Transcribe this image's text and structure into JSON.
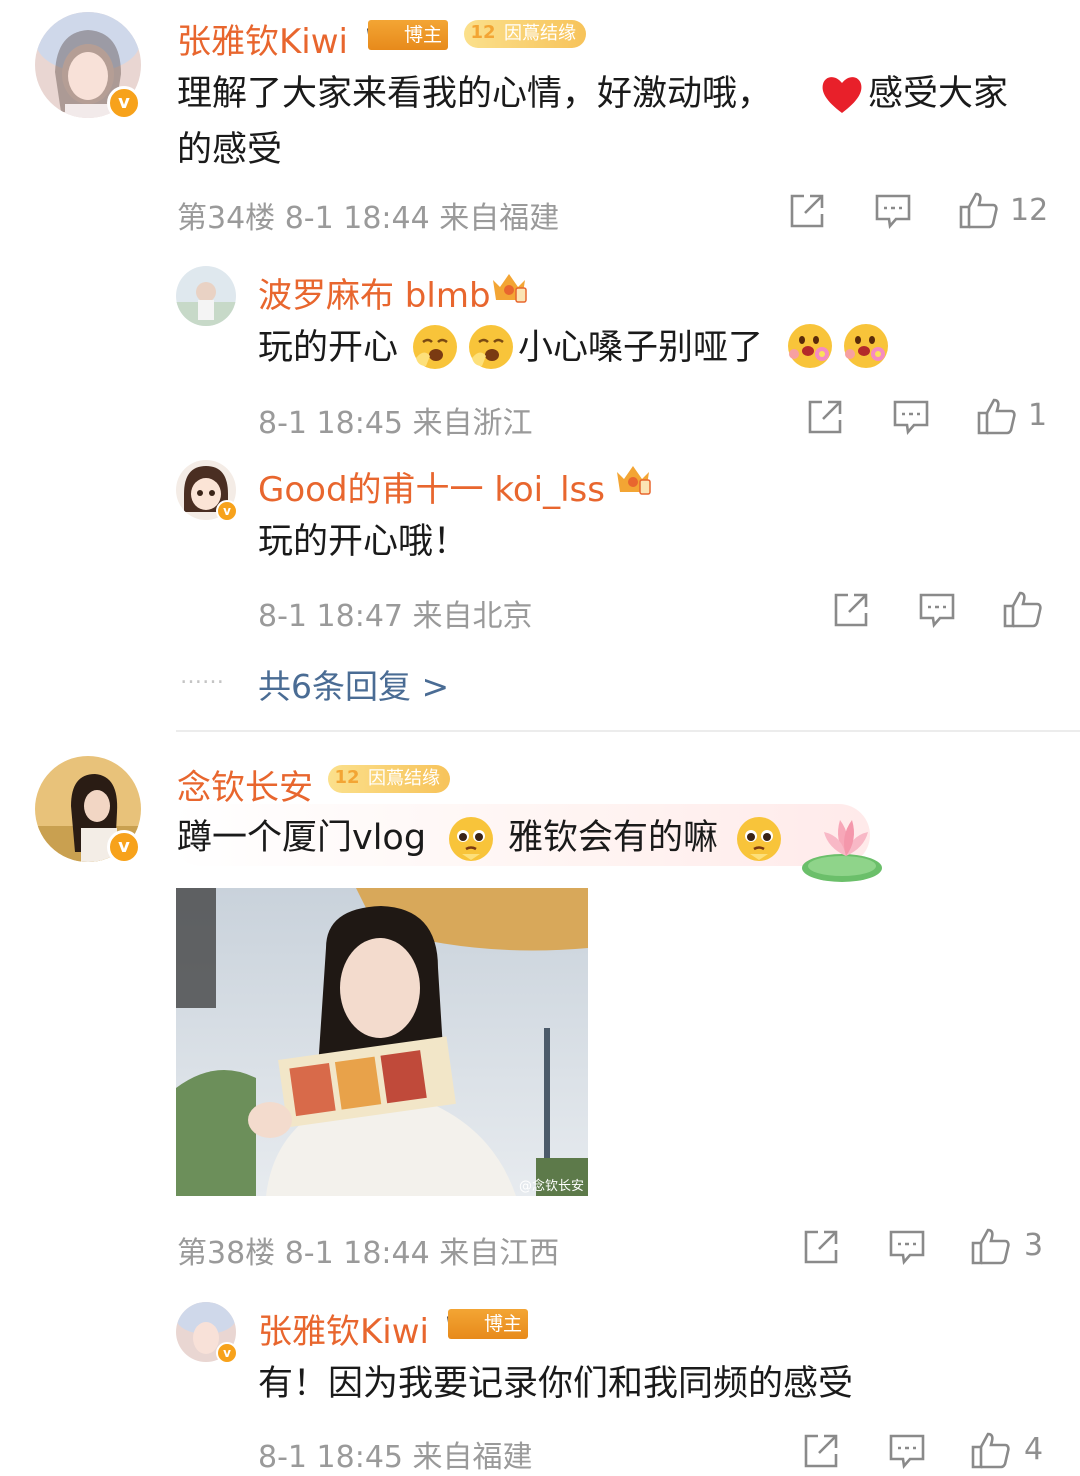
{
  "comments": [
    {
      "user": "张雅钦Kiwi",
      "badge_host": "博主",
      "badge_level_num": "12",
      "badge_level_text": "因蔦结缘",
      "text_line1_a": "理解了大家来看我的心情，好激动哦，",
      "text_line1_b": "感受大家",
      "text_line2": "的感受",
      "meta": "第34楼 8-1 18:44 来自福建",
      "likes": "12",
      "replies": [
        {
          "user": "波罗麻布 blmb",
          "text_a": "玩的开心",
          "text_b": "小心嗓子别哑了",
          "meta": "8-1 18:45 来自浙江",
          "likes": "1"
        },
        {
          "user": "Good的甫十一 koi_lss",
          "text": "玩的开心哦！",
          "meta": "8-1 18:47 来自北京",
          "likes": ""
        }
      ],
      "more_dots": "……",
      "more_label": "共6条回复 >"
    },
    {
      "user": "念钦长安",
      "badge_level_num": "12",
      "badge_level_text": "因蔦结缘",
      "text_a": "蹲一个厦门vlog",
      "text_b": "雅钦会有的嘛",
      "photo_watermark": "@念钦长安",
      "meta": "第38楼 8-1 18:44 来自江西",
      "likes": "3",
      "replies": [
        {
          "user": "张雅钦Kiwi",
          "badge_host": "博主",
          "text": "有！因为我要记录你们和我同频的感受",
          "meta": "8-1 18:45 来自福建",
          "likes": "4"
        }
      ]
    }
  ],
  "icons": {
    "share": "share-icon",
    "comment": "comment-icon",
    "like": "thumbs-up-icon",
    "verified": "verified-v-icon",
    "crown": "crown-icon",
    "heart": "red-heart-emoji",
    "yawn": "yawn-emoji",
    "blush": "flower-blush-emoji",
    "plead": "pleading-emoji",
    "lotus": "lotus-sticker"
  },
  "colors": {
    "username": "#e8662e",
    "meta": "#9a9a9a",
    "more_link": "#4a6c94",
    "verified": "#f7a21b",
    "host_badge": "#f3a534"
  }
}
